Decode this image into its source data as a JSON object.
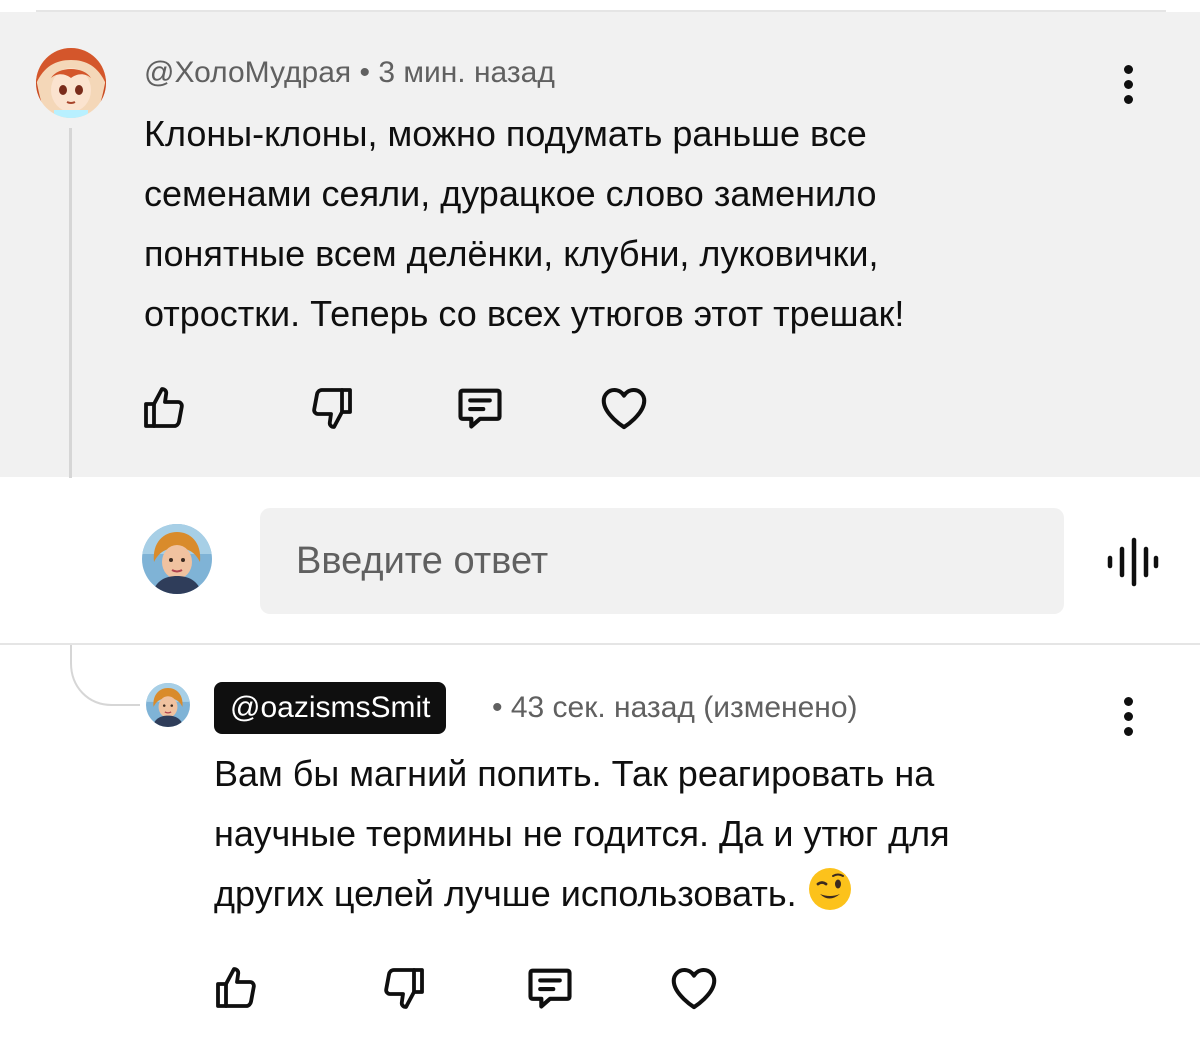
{
  "comment": {
    "author": "@ХолоМудрая",
    "time": "• 3 мин. назад",
    "lines": [
      "Клоны-клоны, можно подумать раньше все",
      "семенами сеяли, дурацкое слово заменило",
      "понятные всем делёнки, клубни, луковички,",
      "отростки. Теперь со всех утюгов этот трешак!"
    ],
    "actions": [
      "like-icon",
      "dislike-icon",
      "reply-icon",
      "heart-icon"
    ]
  },
  "reply_input": {
    "placeholder": "Введите ответ",
    "value": ""
  },
  "reply": {
    "author": "@oazismsSmit",
    "time": "• 43 сек. назад (изменено)",
    "lines": [
      "Вам бы магний попить. Так реагировать на",
      "научные термины не годится. Да и утюг для",
      "других целей лучше использовать."
    ],
    "emoji": "winking-face-emoji",
    "actions": [
      "like-icon",
      "dislike-icon",
      "reply-icon",
      "heart-icon"
    ]
  },
  "colors": {
    "text": "#0f0f0f",
    "meta": "#606060",
    "panel": "#f1f1f1",
    "chip_bg": "#0f0f0f",
    "chip_text": "#ffffff"
  }
}
